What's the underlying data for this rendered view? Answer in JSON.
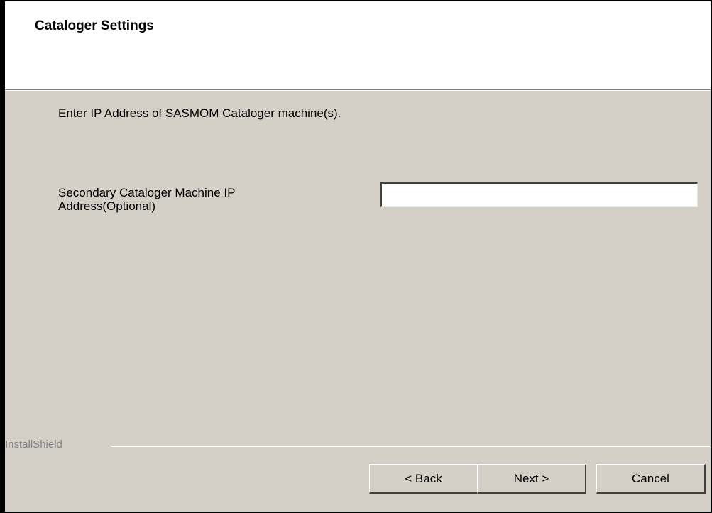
{
  "header": {
    "title": "Cataloger Settings"
  },
  "main": {
    "instruction": "Enter IP Address of SASMOM Cataloger machine(s).",
    "secondary_ip": {
      "label": "Secondary Cataloger Machine IP Address(Optional)",
      "value": "",
      "placeholder": ""
    }
  },
  "footer": {
    "brand": "InstallShield",
    "back_label": "< Back",
    "next_label": "Next >",
    "cancel_label": "Cancel"
  },
  "colors": {
    "dialog_background": "#d4d0c8",
    "header_background": "#ffffff",
    "brand_text": "#808080"
  }
}
